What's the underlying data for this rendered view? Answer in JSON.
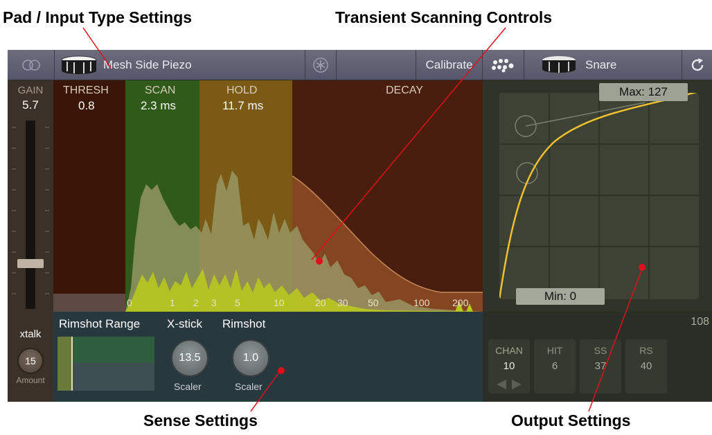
{
  "callouts": {
    "pad_settings": "Pad / Input Type Settings",
    "transient": "Transient Scanning Controls",
    "sense": "Sense Settings",
    "output": "Output Settings"
  },
  "topbar": {
    "pad_type": "Mesh Side Piezo",
    "calibrate": "Calibrate",
    "instrument": "Snare"
  },
  "gain": {
    "label": "GAIN",
    "value": "5.7"
  },
  "zones": {
    "thresh": {
      "label": "THRESH",
      "value": "0.8"
    },
    "scan": {
      "label": "SCAN",
      "value": "2.3 ms"
    },
    "hold": {
      "label": "HOLD",
      "value": "11.7 ms"
    },
    "decay": {
      "label": "DECAY"
    }
  },
  "time_axis": [
    "0",
    "1",
    "2",
    "3",
    "5",
    "10",
    "20",
    "30",
    "50",
    "100",
    "200"
  ],
  "curve": {
    "max": "Max: 127",
    "min": "Min: 0"
  },
  "xtalk": {
    "label": "xtalk",
    "value": "15",
    "sub": "Amount"
  },
  "sense": {
    "rimshot_range": "Rimshot Range",
    "xstick": "X-stick",
    "rimshot": "Rimshot",
    "xstick_value": "13.5",
    "rimshot_value": "1.0",
    "scaler": "Scaler"
  },
  "output": {
    "count": "108",
    "cells": [
      {
        "head": "CHAN",
        "value": "10"
      },
      {
        "head": "HIT",
        "value": "6"
      },
      {
        "head": "SS",
        "value": "37"
      },
      {
        "head": "RS",
        "value": "40"
      }
    ]
  },
  "colors": {
    "scan_zone": "#2f5a1a",
    "hold_zone": "#7a5a14",
    "decay_zone": "#4a1e0e",
    "curve": "#f0c030",
    "marker": "#e0101a"
  }
}
